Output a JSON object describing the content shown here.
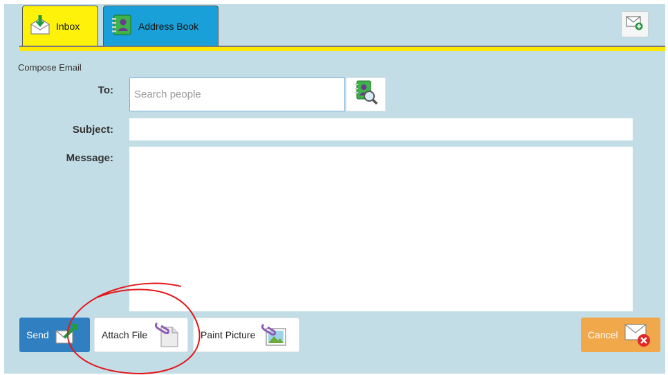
{
  "tabs": [
    {
      "label": "Inbox",
      "icon": "inbox-icon",
      "color": "#fff20a"
    },
    {
      "label": "Address Book",
      "icon": "address-book-icon",
      "color": "#1aa0d8"
    }
  ],
  "header": {
    "new_mail_icon": "new-mail-icon"
  },
  "compose": {
    "title": "Compose Email",
    "to_label": "To:",
    "to_placeholder": "Search people",
    "subject_label": "Subject:",
    "message_label": "Message:",
    "search_people_icon": "address-book-search-icon"
  },
  "actions": {
    "send_label": "Send",
    "attach_label": "Attach File",
    "paint_label": "Paint Picture",
    "cancel_label": "Cancel"
  },
  "colors": {
    "background": "#c3dde6",
    "inbox_tab": "#fff20a",
    "address_tab": "#1aa0d8",
    "send": "#2f7fc1",
    "cancel": "#f0a84a",
    "annotation": "#e3161b"
  }
}
